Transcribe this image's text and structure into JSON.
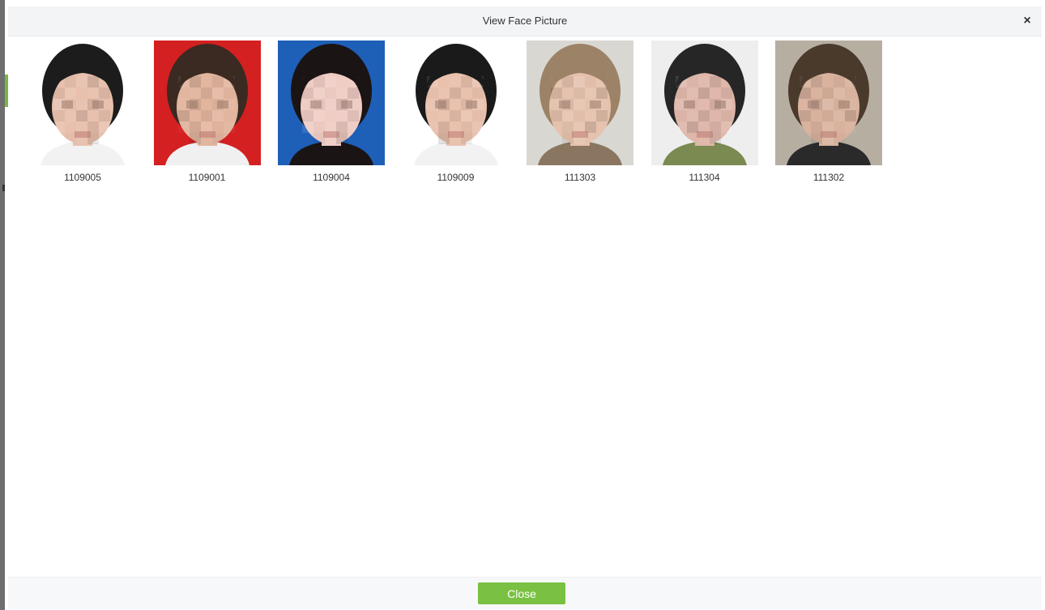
{
  "dialog": {
    "title": "View Face Picture",
    "close_icon": "×",
    "close_button_label": "Close"
  },
  "photos": [
    {
      "id": "1109005",
      "background": "#ffffff",
      "hair": "#1c1c1c",
      "skin": "#e8c0ad",
      "shirt": "#f2f2f2"
    },
    {
      "id": "1109001",
      "background": "#d42020",
      "hair": "#3a2a22",
      "skin": "#e2b59e",
      "shirt": "#f0f0f0"
    },
    {
      "id": "1109004",
      "background": "#1e5fb8",
      "hair": "#1a1414",
      "skin": "#efccc4",
      "shirt": "#1a1414"
    },
    {
      "id": "1109009",
      "background": "#ffffff",
      "hair": "#1a1a1a",
      "skin": "#e9c1ad",
      "shirt": "#f2f2f2"
    },
    {
      "id": "111303",
      "background": "#d9d7d2",
      "hair": "#9c8266",
      "skin": "#e5c2ad",
      "shirt": "#8a7660"
    },
    {
      "id": "111304",
      "background": "#eeeeee",
      "hair": "#262626",
      "skin": "#dfb7aa",
      "shirt": "#7a8a50"
    },
    {
      "id": "111302",
      "background": "#b7aea2",
      "hair": "#4a3a2c",
      "skin": "#d9b29e",
      "shirt": "#2a2a2a"
    }
  ]
}
